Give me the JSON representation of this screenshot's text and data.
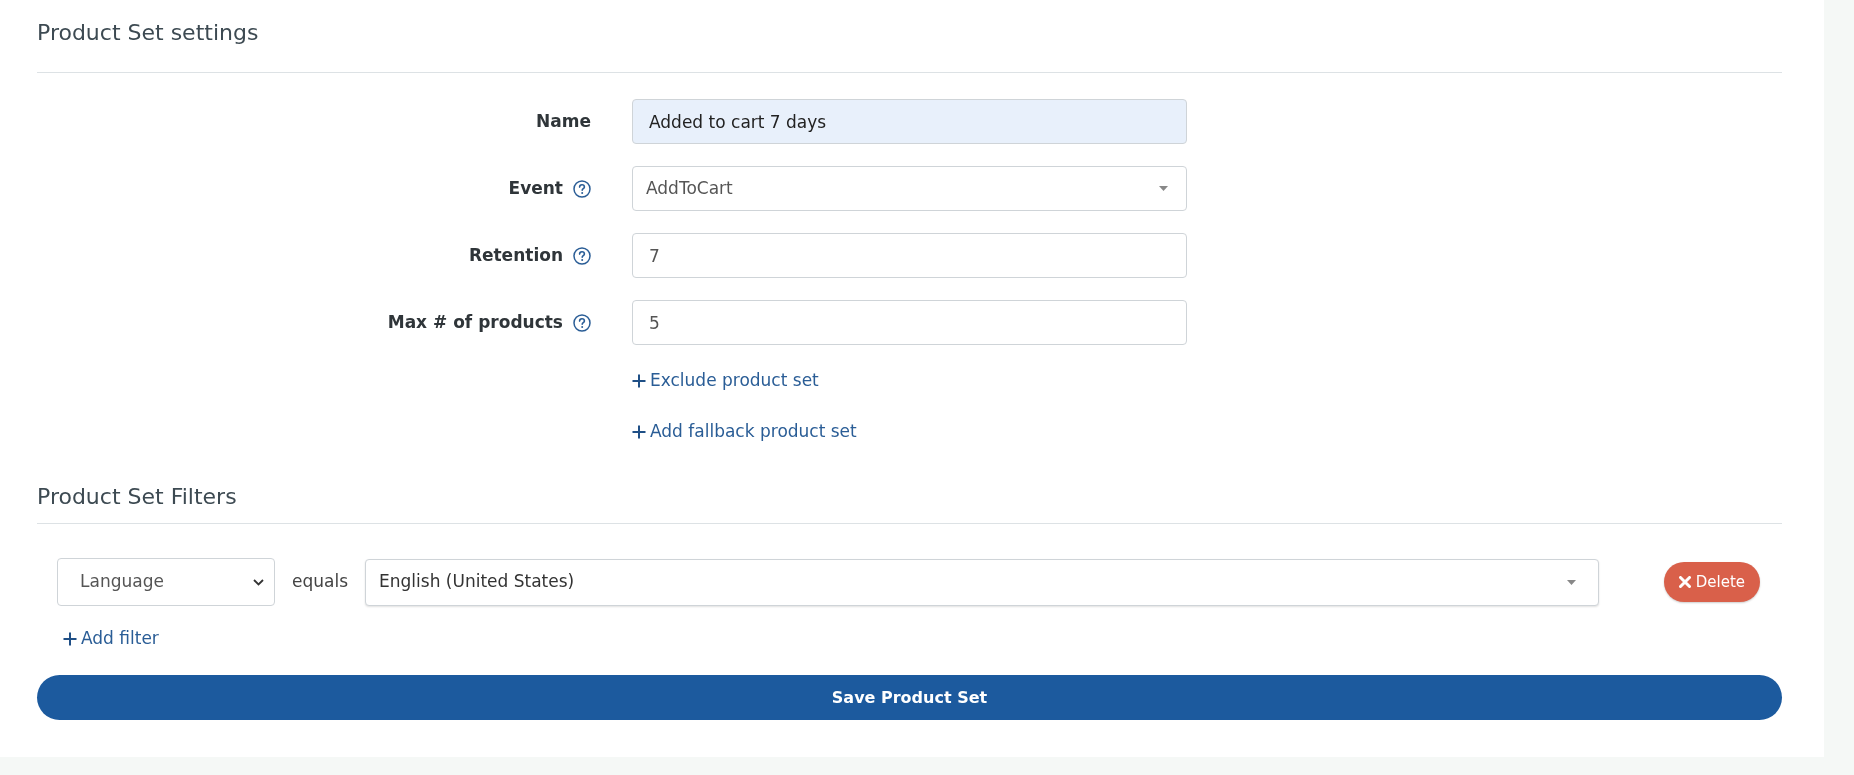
{
  "settings": {
    "title": "Product Set settings",
    "fields": [
      {
        "label": "Name",
        "kind": "text",
        "value": "Added to cart 7 days",
        "help": false,
        "autofilled": true
      },
      {
        "label": "Event",
        "kind": "dropdown",
        "value": "AddToCart",
        "help": true,
        "autofilled": false
      },
      {
        "label": "Retention",
        "kind": "text",
        "value": "7",
        "help": true,
        "autofilled": false
      },
      {
        "label": "Max # of products",
        "kind": "text",
        "value": "5",
        "help": true,
        "autofilled": false
      }
    ],
    "links": [
      "Exclude product set",
      "Add fallback product set"
    ]
  },
  "filters": {
    "title": "Product Set Filters",
    "rows": [
      {
        "field": "Language",
        "operator": "equals",
        "value": "English (United States)",
        "delete_label": "Delete"
      }
    ],
    "add_link": "Add filter"
  },
  "save_button": "Save Product Set"
}
